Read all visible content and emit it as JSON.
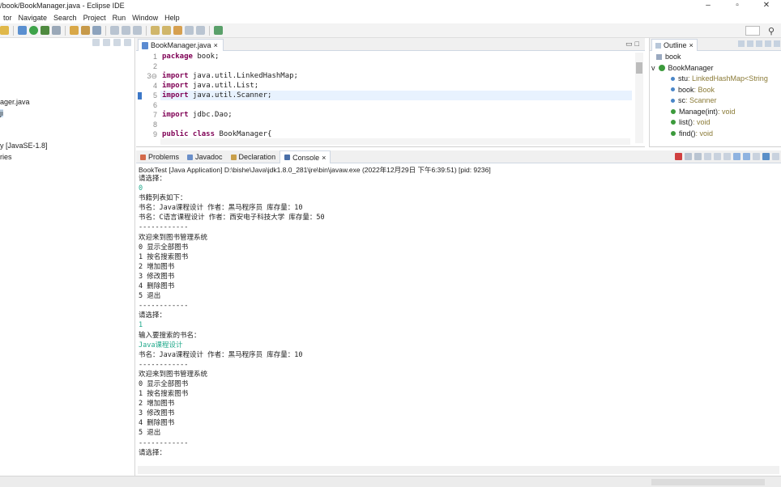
{
  "window": {
    "title": "/book/BookManager.java - Eclipse IDE",
    "controls": [
      "–",
      "▫",
      "✕"
    ]
  },
  "menubar": [
    "tor",
    "Navigate",
    "Search",
    "Project",
    "Run",
    "Window",
    "Help"
  ],
  "package_explorer": {
    "items": [
      "ager.java",
      "ji",
      "y [JavaSE-1.8]",
      "ries"
    ]
  },
  "editor": {
    "tab_label": "BookManager.java",
    "tab_close": "×",
    "lines": [
      {
        "num": "1",
        "parts": [
          [
            "kw",
            "package"
          ],
          [
            "",
            " book;"
          ]
        ]
      },
      {
        "num": "2",
        "parts": [
          [
            "",
            ""
          ]
        ]
      },
      {
        "num": "3⊖",
        "parts": [
          [
            "kw",
            "import"
          ],
          [
            "",
            " java.util.LinkedHashMap;"
          ]
        ]
      },
      {
        "num": "4",
        "parts": [
          [
            "kw",
            "import"
          ],
          [
            "",
            " java.util.List;"
          ]
        ]
      },
      {
        "num": "5",
        "parts": [
          [
            "kw",
            "import"
          ],
          [
            "",
            " java.util.Scanner;"
          ]
        ],
        "highlight": true
      },
      {
        "num": "6",
        "parts": [
          [
            "",
            ""
          ]
        ]
      },
      {
        "num": "7",
        "parts": [
          [
            "kw",
            "import"
          ],
          [
            "",
            " jdbc.Dao;"
          ]
        ]
      },
      {
        "num": "8",
        "parts": [
          [
            "",
            ""
          ]
        ]
      },
      {
        "num": "9",
        "parts": [
          [
            "kw",
            "public class"
          ],
          [
            "",
            " BookManager{"
          ]
        ]
      }
    ]
  },
  "outline": {
    "tab_label": "Outline",
    "tab_close": "×",
    "items": [
      {
        "name": "book",
        "type": "",
        "indent": 0,
        "icon": "package"
      },
      {
        "name": "BookManager",
        "type": "",
        "indent": 0,
        "icon": "class",
        "expanded": "v"
      },
      {
        "name": "stu",
        "type": " : LinkedHashMap<String",
        "indent": 1,
        "icon": "field"
      },
      {
        "name": "book",
        "type": " : Book",
        "indent": 1,
        "icon": "field"
      },
      {
        "name": "sc",
        "type": " : Scanner",
        "indent": 1,
        "icon": "field"
      },
      {
        "name": "Manage(int)",
        "type": " : void",
        "indent": 1,
        "icon": "method"
      },
      {
        "name": "list()",
        "type": " : void",
        "indent": 1,
        "icon": "method"
      },
      {
        "name": "find()",
        "type": " : void",
        "indent": 1,
        "icon": "method"
      }
    ]
  },
  "console": {
    "tabs": [
      {
        "label": "Problems",
        "active": false
      },
      {
        "label": "Javadoc",
        "active": false
      },
      {
        "label": "Declaration",
        "active": false
      },
      {
        "label": "Console",
        "active": true,
        "close": "×"
      }
    ],
    "launch_info": "BookTest [Java Application] D:\\bishe\\Java\\jdk1.8.0_281\\jre\\bin\\javaw.exe  (2022年12月29日 下午6:39:51) [pid: 9236]",
    "output": [
      {
        "text": "请选择：",
        "input": false
      },
      {
        "text": "0",
        "input": true
      },
      {
        "text": "书籍列表如下：",
        "input": false
      },
      {
        "text": "书名：Java课程设计 作者：黑马程序员 库存量：10",
        "input": false
      },
      {
        "text": "书名：C语言课程设计 作者：西安电子科技大学 库存量：50",
        "input": false
      },
      {
        "text": "------------",
        "input": false
      },
      {
        "text": "欢迎来到图书管理系统",
        "input": false
      },
      {
        "text": "0 显示全部图书",
        "input": false
      },
      {
        "text": "1 按名搜索图书",
        "input": false
      },
      {
        "text": "2 增加图书",
        "input": false
      },
      {
        "text": "3 修改图书",
        "input": false
      },
      {
        "text": "4 删除图书",
        "input": false
      },
      {
        "text": "5 退出",
        "input": false
      },
      {
        "text": "------------",
        "input": false
      },
      {
        "text": "请选择：",
        "input": false
      },
      {
        "text": "1",
        "input": true
      },
      {
        "text": "输入要搜索的书名：",
        "input": false
      },
      {
        "text": "Java课程设计",
        "input": true
      },
      {
        "text": "书名：Java课程设计 作者：黑马程序员 库存量：10",
        "input": false
      },
      {
        "text": "------------",
        "input": false
      },
      {
        "text": "欢迎来到图书管理系统",
        "input": false
      },
      {
        "text": "0 显示全部图书",
        "input": false
      },
      {
        "text": "1 按名搜索图书",
        "input": false
      },
      {
        "text": "2 增加图书",
        "input": false
      },
      {
        "text": "3 修改图书",
        "input": false
      },
      {
        "text": "4 删除图书",
        "input": false
      },
      {
        "text": "5 退出",
        "input": false
      },
      {
        "text": "------------",
        "input": false
      },
      {
        "text": "请选择：",
        "input": false
      }
    ]
  },
  "colors": {
    "keyword": "#7f0055",
    "user_input": "#1fa88a",
    "line_highlight": "#e8f2fe",
    "selection": "#cde3f7"
  }
}
